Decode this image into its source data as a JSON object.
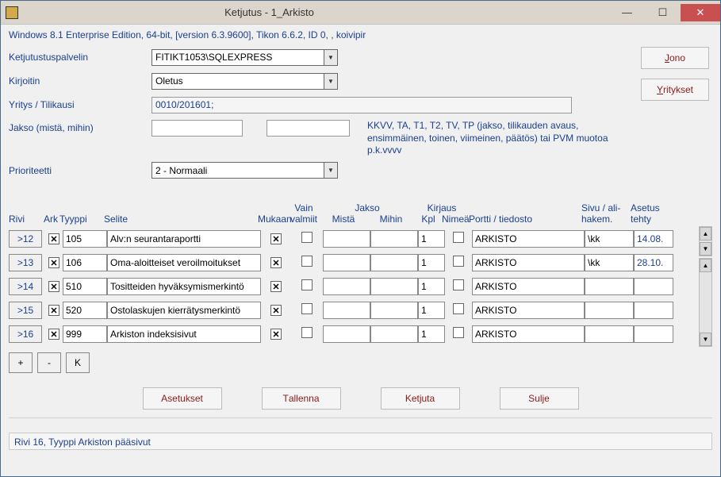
{
  "window": {
    "title": "Ketjutus - 1_Arkisto"
  },
  "sysinfo": "Windows 8.1 Enterprise Edition, 64-bit, [version 6.3.9600], Tikon 6.6.2, ID 0, , koivipir",
  "labels": {
    "palvelin": "Ketjutustuspalvelin",
    "kirjoitin": "Kirjoitin",
    "yritys": "Yritys / Tilikausi",
    "jakso": "Jakso (mistä, mihin)",
    "prioriteetti": "Prioriteetti"
  },
  "fields": {
    "palvelin": "FITIKT1053\\SQLEXPRESS",
    "kirjoitin": "Oletus",
    "yritys": "0010/201601;",
    "jakso_from": "",
    "jakso_to": "",
    "prioriteetti": "2 - Normaali"
  },
  "jakso_help": "KKVV, TA, T1, T2, TV, TP (jakso, tilikauden avaus, ensimmäinen, toinen, viimeinen, päätös)  tai PVM muotoa p.k.vvvv",
  "side": {
    "jono": "Jono",
    "yritykset": "Yritykset"
  },
  "headers": {
    "rivi": "Rivi",
    "ark": "Ark",
    "tyyppi": "Tyyppi",
    "selite": "Selite",
    "mukaan": "Mukaan",
    "vain": "Vain valmiit",
    "jakso": "Jakso",
    "mista": "Mistä",
    "mihin": "Mihin",
    "kirjaus": "Kirjaus",
    "kpl": "Kpl",
    "nimea": "Nimeä",
    "portti": "Portti / tiedosto",
    "sivu": "Sivu / ali-\nhakem.",
    "asetus": "Asetus tehty"
  },
  "rows": [
    {
      "rivi": ">12",
      "ark": true,
      "tyyppi": "105",
      "selite": "Alv:n seurantaraportti",
      "mukaan": true,
      "vain": false,
      "mista": "",
      "mihin": "",
      "kpl": "1",
      "nimea": false,
      "portti": "ARKISTO",
      "sivu": "\\kk",
      "asetus": "14.08."
    },
    {
      "rivi": ">13",
      "ark": true,
      "tyyppi": "106",
      "selite": "Oma-aloitteiset veroilmoitukset",
      "mukaan": true,
      "vain": false,
      "mista": "",
      "mihin": "",
      "kpl": "1",
      "nimea": false,
      "portti": "ARKISTO",
      "sivu": "\\kk",
      "asetus": "28.10."
    },
    {
      "rivi": ">14",
      "ark": true,
      "tyyppi": "510",
      "selite": "Tositteiden hyväksymismerkintö",
      "mukaan": true,
      "vain": false,
      "mista": "",
      "mihin": "",
      "kpl": "1",
      "nimea": false,
      "portti": "ARKISTO",
      "sivu": "",
      "asetus": ""
    },
    {
      "rivi": ">15",
      "ark": true,
      "tyyppi": "520",
      "selite": "Ostolaskujen kierrätysmerkintö",
      "mukaan": true,
      "vain": false,
      "mista": "",
      "mihin": "",
      "kpl": "1",
      "nimea": false,
      "portti": "ARKISTO",
      "sivu": "",
      "asetus": ""
    },
    {
      "rivi": ">16",
      "ark": true,
      "tyyppi": "999",
      "selite": "Arkiston indeksisivut",
      "mukaan": true,
      "vain": false,
      "mista": "",
      "mihin": "",
      "kpl": "1",
      "nimea": false,
      "portti": "ARKISTO",
      "sivu": "",
      "asetus": ""
    }
  ],
  "row_ctrls": {
    "plus": "+",
    "minus": "-",
    "k": "K"
  },
  "actions": {
    "asetukset": "Asetukset",
    "tallenna": "Tallenna",
    "ketjuta": "Ketjuta",
    "sulje": "Sulje"
  },
  "status": "Rivi 16, Tyyppi Arkiston pääsivut"
}
